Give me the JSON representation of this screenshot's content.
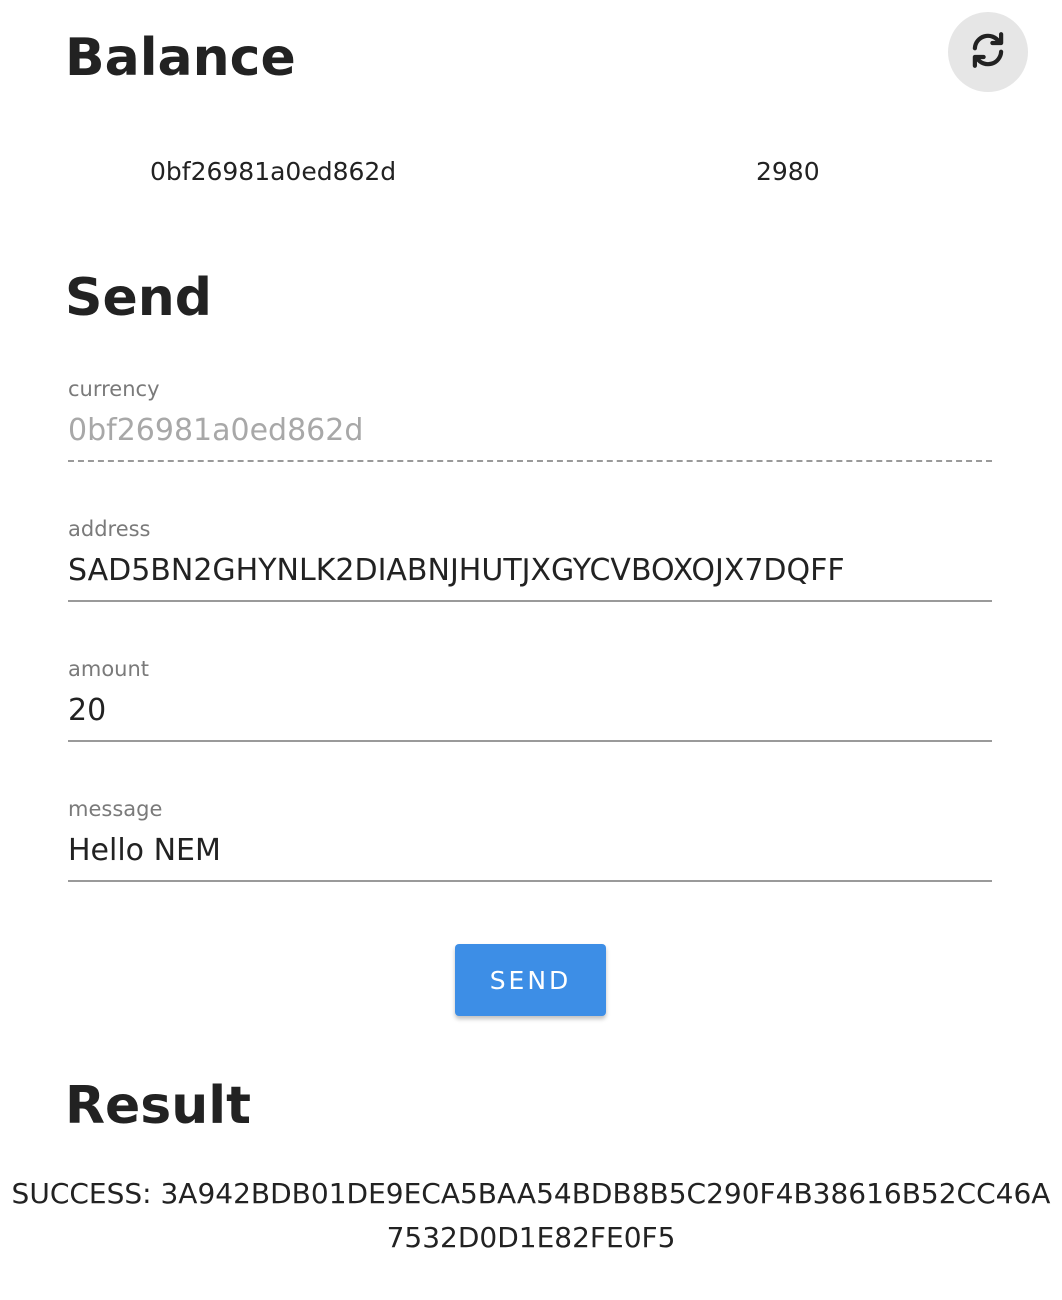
{
  "balance": {
    "title": "Balance",
    "refresh_icon": "refresh-icon",
    "rows": [
      {
        "currency": "0bf26981a0ed862d",
        "amount": "2980"
      }
    ]
  },
  "send": {
    "title": "Send",
    "currency": {
      "label": "currency",
      "value": "0bf26981a0ed862d"
    },
    "address": {
      "label": "address",
      "value": "SAD5BN2GHYNLK2DIABNJHUTJXGYCVBOXOJX7DQFF"
    },
    "amount": {
      "label": "amount",
      "value": "20"
    },
    "message": {
      "label": "message",
      "value": "Hello NEM"
    },
    "button_label": "SEND"
  },
  "result": {
    "title": "Result",
    "text": "SUCCESS: 3A942BDB01DE9ECA5BAA54BDB8B5C290F4B38616B52CC46A7532D0D1E82FE0F5"
  },
  "colors": {
    "accent": "#3d8ee6",
    "refresh_button_bg": "#e6e6e6",
    "label_text": "#7a7a7a",
    "disabled_text": "#a8a8a8"
  }
}
